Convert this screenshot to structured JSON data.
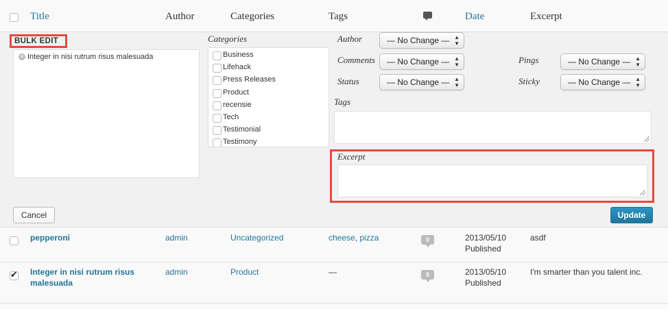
{
  "header": {
    "title": "Title",
    "author": "Author",
    "categories": "Categories",
    "tags": "Tags",
    "date": "Date",
    "excerpt": "Excerpt"
  },
  "bulk_edit": {
    "heading": "BULK EDIT",
    "posts": [
      "Integer in nisi rutrum risus malesuada"
    ],
    "categories_label": "Categories",
    "categories": [
      "Business",
      "Lifehack",
      "Press Releases",
      "Product",
      "recensie",
      "Tech",
      "Testimonial",
      "Testimony"
    ],
    "author_label": "Author",
    "comments_label": "Comments",
    "status_label": "Status",
    "pings_label": "Pings",
    "sticky_label": "Sticky",
    "select_value": "— No Change —",
    "tags_label": "Tags",
    "excerpt_label": "Excerpt",
    "cancel": "Cancel",
    "update": "Update"
  },
  "rows": [
    {
      "title": "pepperoni",
      "author": "admin",
      "category": "Uncategorized",
      "tag1": "cheese",
      "tag_sep": ", ",
      "tag2": "pizza",
      "comments": "0",
      "date": "2013/05/10",
      "status": "Published",
      "excerpt": "asdf",
      "checked": false
    },
    {
      "title_line1": "Integer in nisi rutrum risus",
      "title_line2": "malesuada",
      "author": "admin",
      "category": "Product",
      "tags": "—",
      "comments": "0",
      "date": "2013/05/10",
      "status": "Published",
      "excerpt": "I'm smarter than you talent inc.",
      "checked": true
    }
  ]
}
